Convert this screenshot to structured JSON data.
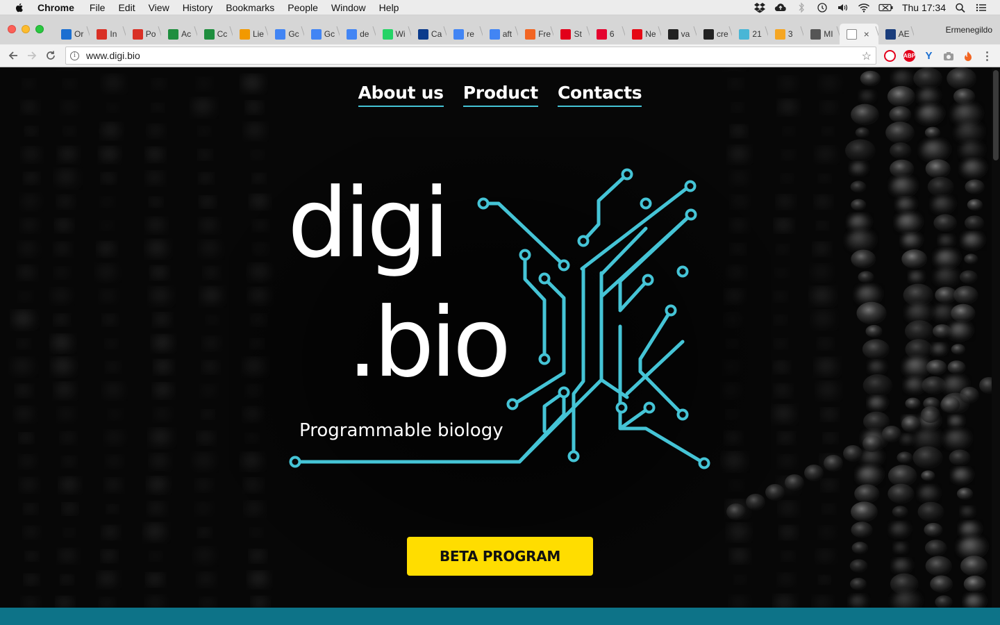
{
  "menubar": {
    "app": "Chrome",
    "items": [
      "File",
      "Edit",
      "View",
      "History",
      "Bookmarks",
      "People",
      "Window",
      "Help"
    ],
    "clock": "Thu 17:34"
  },
  "tabs": [
    {
      "label": "Or",
      "icon": "yammer-icon",
      "color": "#1b6fd1"
    },
    {
      "label": "In",
      "icon": "gmail-icon",
      "color": "#d93025"
    },
    {
      "label": "Po",
      "icon": "gmail-icon",
      "color": "#d93025"
    },
    {
      "label": "Ac",
      "icon": "sheets-icon",
      "color": "#1e8e3e"
    },
    {
      "label": "Cc",
      "icon": "sheets-icon",
      "color": "#1e8e3e"
    },
    {
      "label": "Lie",
      "icon": "house-icon",
      "color": "#f29900"
    },
    {
      "label": "Gc",
      "icon": "calendar-icon",
      "color": "#4285f4"
    },
    {
      "label": "Gc",
      "icon": "translate-icon",
      "color": "#4285f4"
    },
    {
      "label": "de",
      "icon": "google-icon",
      "color": "#4285f4"
    },
    {
      "label": "Wi",
      "icon": "whatsapp-icon",
      "color": "#25d366"
    },
    {
      "label": "Ca",
      "icon": "rai-icon",
      "color": "#0b3b8c"
    },
    {
      "label": "re",
      "icon": "google-icon",
      "color": "#4285f4"
    },
    {
      "label": "aft",
      "icon": "google-icon",
      "color": "#4285f4"
    },
    {
      "label": "Fre",
      "icon": "m-icon",
      "color": "#f26522"
    },
    {
      "label": "St",
      "icon": "t-icon",
      "color": "#e2001a"
    },
    {
      "label": "6",
      "icon": "u-icon",
      "color": "#e4032e"
    },
    {
      "label": "Ne",
      "icon": "netflix-icon",
      "color": "#e50914"
    },
    {
      "label": "va",
      "icon": "boxed-icon",
      "color": "#222222"
    },
    {
      "label": "cre",
      "icon": "boxed-icon",
      "color": "#222222"
    },
    {
      "label": "21",
      "icon": "gear-icon",
      "color": "#49b6d6"
    },
    {
      "label": "3",
      "icon": "ring-icon",
      "color": "#f5a623"
    },
    {
      "label": "MI",
      "icon": "face-icon",
      "color": "#555555"
    },
    {
      "label": "",
      "icon": "document-icon",
      "color": "#888888",
      "active": true
    },
    {
      "label": "AE",
      "icon": "ae-icon",
      "color": "#1a3d7c"
    }
  ],
  "profile": "Ermenegildo",
  "omnibox": {
    "url": "www.digi.bio"
  },
  "site": {
    "nav": [
      "About us",
      "Product",
      "Contacts"
    ],
    "logo_line1": "digi",
    "logo_line2": ".bio",
    "tagline": "Programmable biology",
    "cta": "BETA PROGRAM",
    "accent": "#45c4d6",
    "cta_color": "#ffdd00",
    "band_color": "#0d7388"
  }
}
